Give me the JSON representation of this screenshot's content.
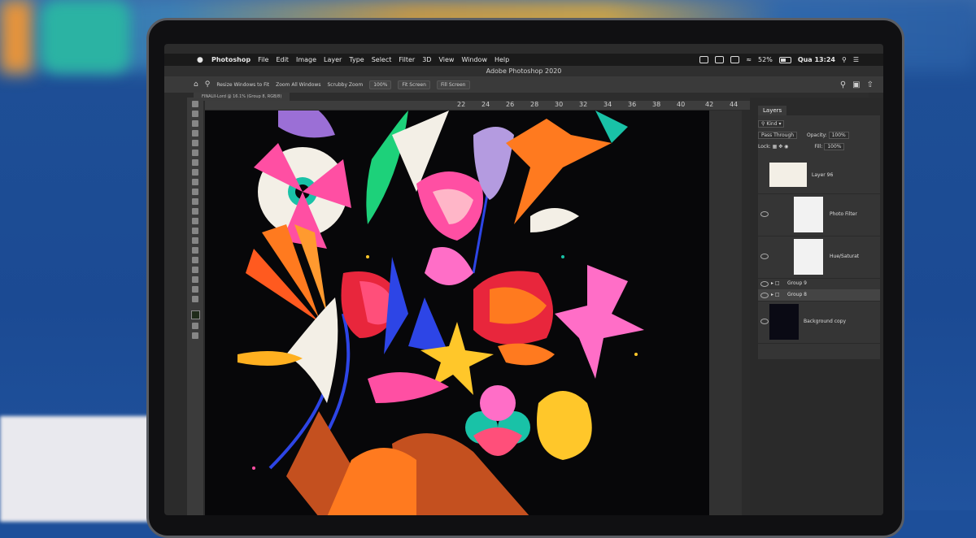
{
  "menubar": {
    "app_name": "Photoshop",
    "items": [
      "File",
      "Edit",
      "Image",
      "Layer",
      "Type",
      "Select",
      "Filter",
      "3D",
      "View",
      "Window",
      "Help"
    ],
    "battery": "52%",
    "clock": "Qua 13:24"
  },
  "window": {
    "title": "Adobe Photoshop 2020"
  },
  "options_bar": {
    "items": [
      "Resize Windows to Fit",
      "Zoom All Windows",
      "Scrubby Zoom",
      "100%",
      "Fit Screen",
      "Fill Screen"
    ]
  },
  "document_tab": "FINALII-Lord @ 16.1% (Group 8, RGB/8)",
  "ruler": {
    "ticks": [
      "22",
      "24",
      "26",
      "28",
      "30",
      "32",
      "34",
      "36",
      "38",
      "40",
      "42",
      "44"
    ]
  },
  "layers_panel": {
    "tab_label": "Layers",
    "filter_label": "Kind",
    "blend_mode": "Pass Through",
    "opacity_label": "Opacity:",
    "opacity_value": "100%",
    "lock_label": "Lock:",
    "fill_label": "Fill:",
    "fill_value": "100%",
    "layers": [
      {
        "name": "Layer 96"
      },
      {
        "name": "Photo Filter"
      },
      {
        "name": "Hue/Saturat"
      },
      {
        "name": "Group 9"
      },
      {
        "name": "Group 8"
      },
      {
        "name": "Background copy"
      }
    ]
  },
  "colors": {
    "artwork_bg": "#070709",
    "pink": "#ff4fa3",
    "orange": "#ff7a1f",
    "yellow": "#ffc72a",
    "blue": "#2d45e6",
    "teal": "#19c2a7",
    "red": "#e8263c",
    "purple": "#9b6fd6"
  }
}
